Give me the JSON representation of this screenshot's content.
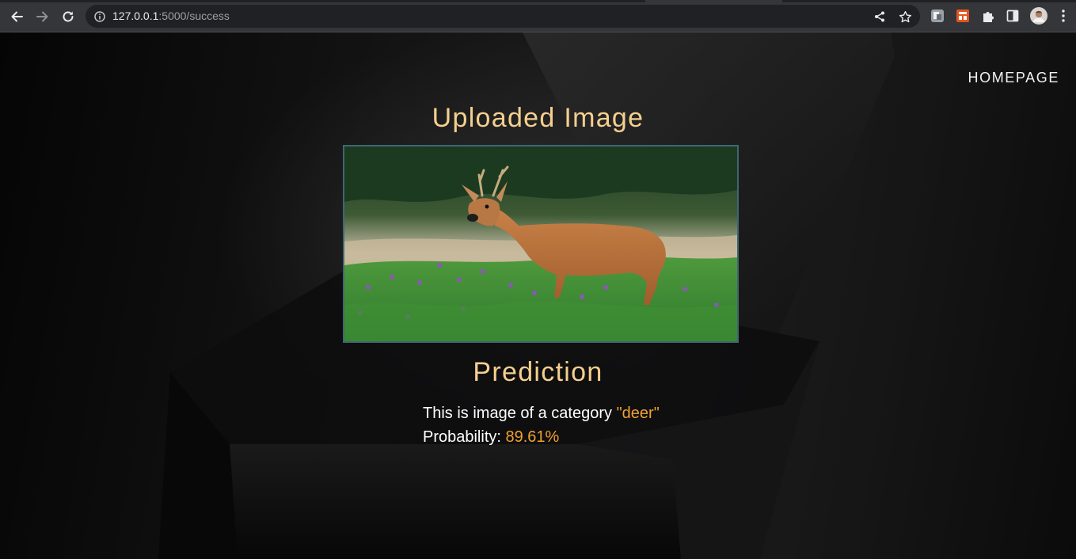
{
  "browser": {
    "url_host": "127.0.0.1",
    "url_path": ":5000/success",
    "icons": {
      "back": "arrow-left-icon",
      "forward": "arrow-right-icon",
      "reload": "reload-icon",
      "site_info": "info-icon",
      "share": "share-icon",
      "bookmark": "star-icon",
      "extension_1": "extension-app-icon",
      "extension_2": "extension-app-icon",
      "extensions": "puzzle-icon",
      "side_panel": "side-panel-icon",
      "profile": "avatar",
      "menu": "kebab-menu-icon"
    }
  },
  "nav": {
    "homepage_label": "HOMEPAGE"
  },
  "upload": {
    "heading": "Uploaded Image",
    "image_subject": "deer"
  },
  "prediction": {
    "heading": "Prediction",
    "category_prefix": "This is image of a category ",
    "category_value": "\"deer\"",
    "probability_prefix": "Probability: ",
    "probability_value": "89.61%"
  },
  "colors": {
    "heading": "#f5cf8e",
    "accent": "#f0a031",
    "text": "#ffffff",
    "frame_border": "#3f6673"
  }
}
